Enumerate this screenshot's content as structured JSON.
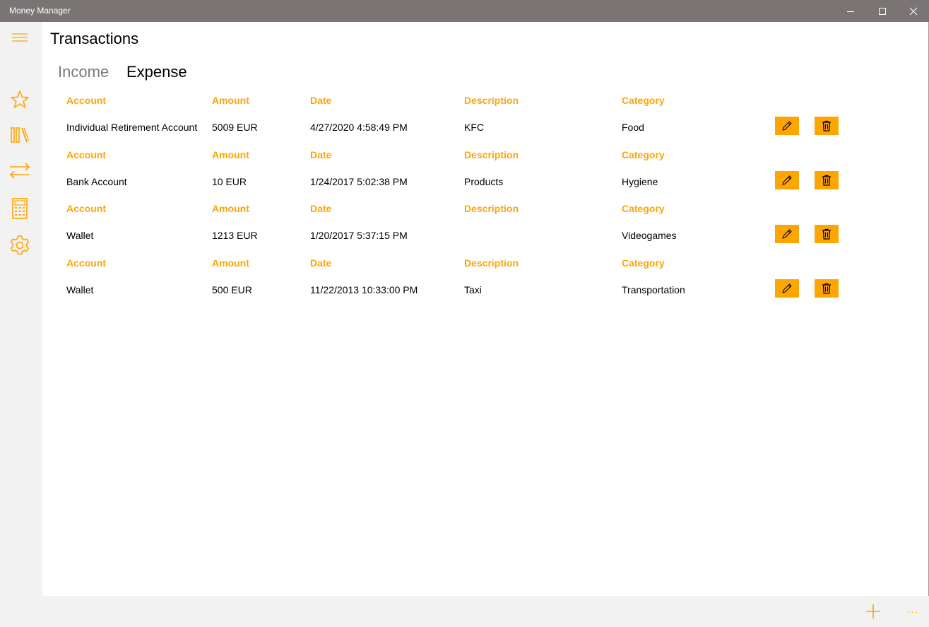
{
  "window": {
    "title": "Money Manager"
  },
  "page": {
    "title": "Transactions"
  },
  "tabs": {
    "income": "Income",
    "expense": "Expense",
    "selected": "Expense"
  },
  "nav": [
    {
      "name": "menu",
      "icon": "hamburger-icon"
    },
    {
      "name": "favorites",
      "icon": "star-icon"
    },
    {
      "name": "accounts",
      "icon": "library-icon"
    },
    {
      "name": "transactions",
      "icon": "transfer-arrows-icon"
    },
    {
      "name": "calculator",
      "icon": "calculator-icon"
    },
    {
      "name": "settings",
      "icon": "gear-icon"
    }
  ],
  "headers": {
    "account": "Account",
    "amount": "Amount",
    "date": "Date",
    "description": "Description",
    "category": "Category"
  },
  "transactions": [
    {
      "account": "Individual Retirement Account",
      "amount": "5009 EUR",
      "date": "4/27/2020 4:58:49 PM",
      "description": "KFC",
      "category": "Food"
    },
    {
      "account": "Bank Account",
      "amount": "10 EUR",
      "date": "1/24/2017 5:02:38 PM",
      "description": "Products",
      "category": "Hygiene"
    },
    {
      "account": "Wallet",
      "amount": "1213 EUR",
      "date": "1/20/2017 5:37:15 PM",
      "description": "",
      "category": "Videogames"
    },
    {
      "account": "Wallet",
      "amount": "500 EUR",
      "date": "11/22/2013 10:33:00 PM",
      "description": "Taxi",
      "category": "Transportation"
    }
  ],
  "actions": {
    "edit_icon": "pencil-icon",
    "delete_icon": "trash-icon"
  },
  "appbar": {
    "add_icon": "plus-icon",
    "more_label": "···"
  },
  "colors": {
    "accent": "#ffa500",
    "titlebar": "#7a7574",
    "sidebar": "#f2f2f2"
  }
}
